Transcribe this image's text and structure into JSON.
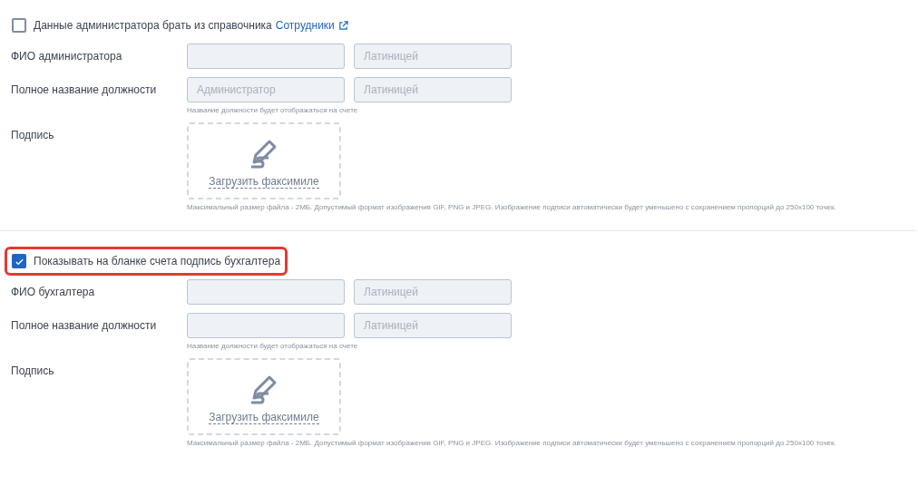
{
  "sections": [
    {
      "checkbox": {
        "label": "Данные администратора брать из справочника",
        "checked": false,
        "link": "Сотрудники"
      },
      "name_row": {
        "label": "ФИО администратора",
        "latin_placeholder": "Латиницей"
      },
      "position_row": {
        "label": "Полное название должности",
        "placeholder": "Администратор",
        "latin_placeholder": "Латиницей",
        "hint": "Название должности будет отображаться на счете"
      },
      "signature_row": {
        "label": "Подпись",
        "upload": "Загрузить факсимиле",
        "hint": "Максимальный размер файла - 2МБ. Допустимый формат изображения GIF, PNG и JPEG. Изображение подписи автоматически будет уменьшено с сохранением пропорций до 250x100 точек."
      }
    },
    {
      "checkbox": {
        "label": "Показывать на бланке счета подпись бухгалтера",
        "checked": true,
        "highlighted": true
      },
      "name_row": {
        "label": "ФИО бухгалтера",
        "latin_placeholder": "Латиницей"
      },
      "position_row": {
        "label": "Полное название должности",
        "latin_placeholder": "Латиницей",
        "hint": "Название должности будет отображаться на счете"
      },
      "signature_row": {
        "label": "Подпись",
        "upload": "Загрузить факсимиле",
        "hint": "Максимальный размер файла - 2МБ. Допустимый формат изображения GIF, PNG и JPEG. Изображение подписи автоматически будет уменьшено с сохранением пропорций до 250x100 точек."
      }
    }
  ]
}
